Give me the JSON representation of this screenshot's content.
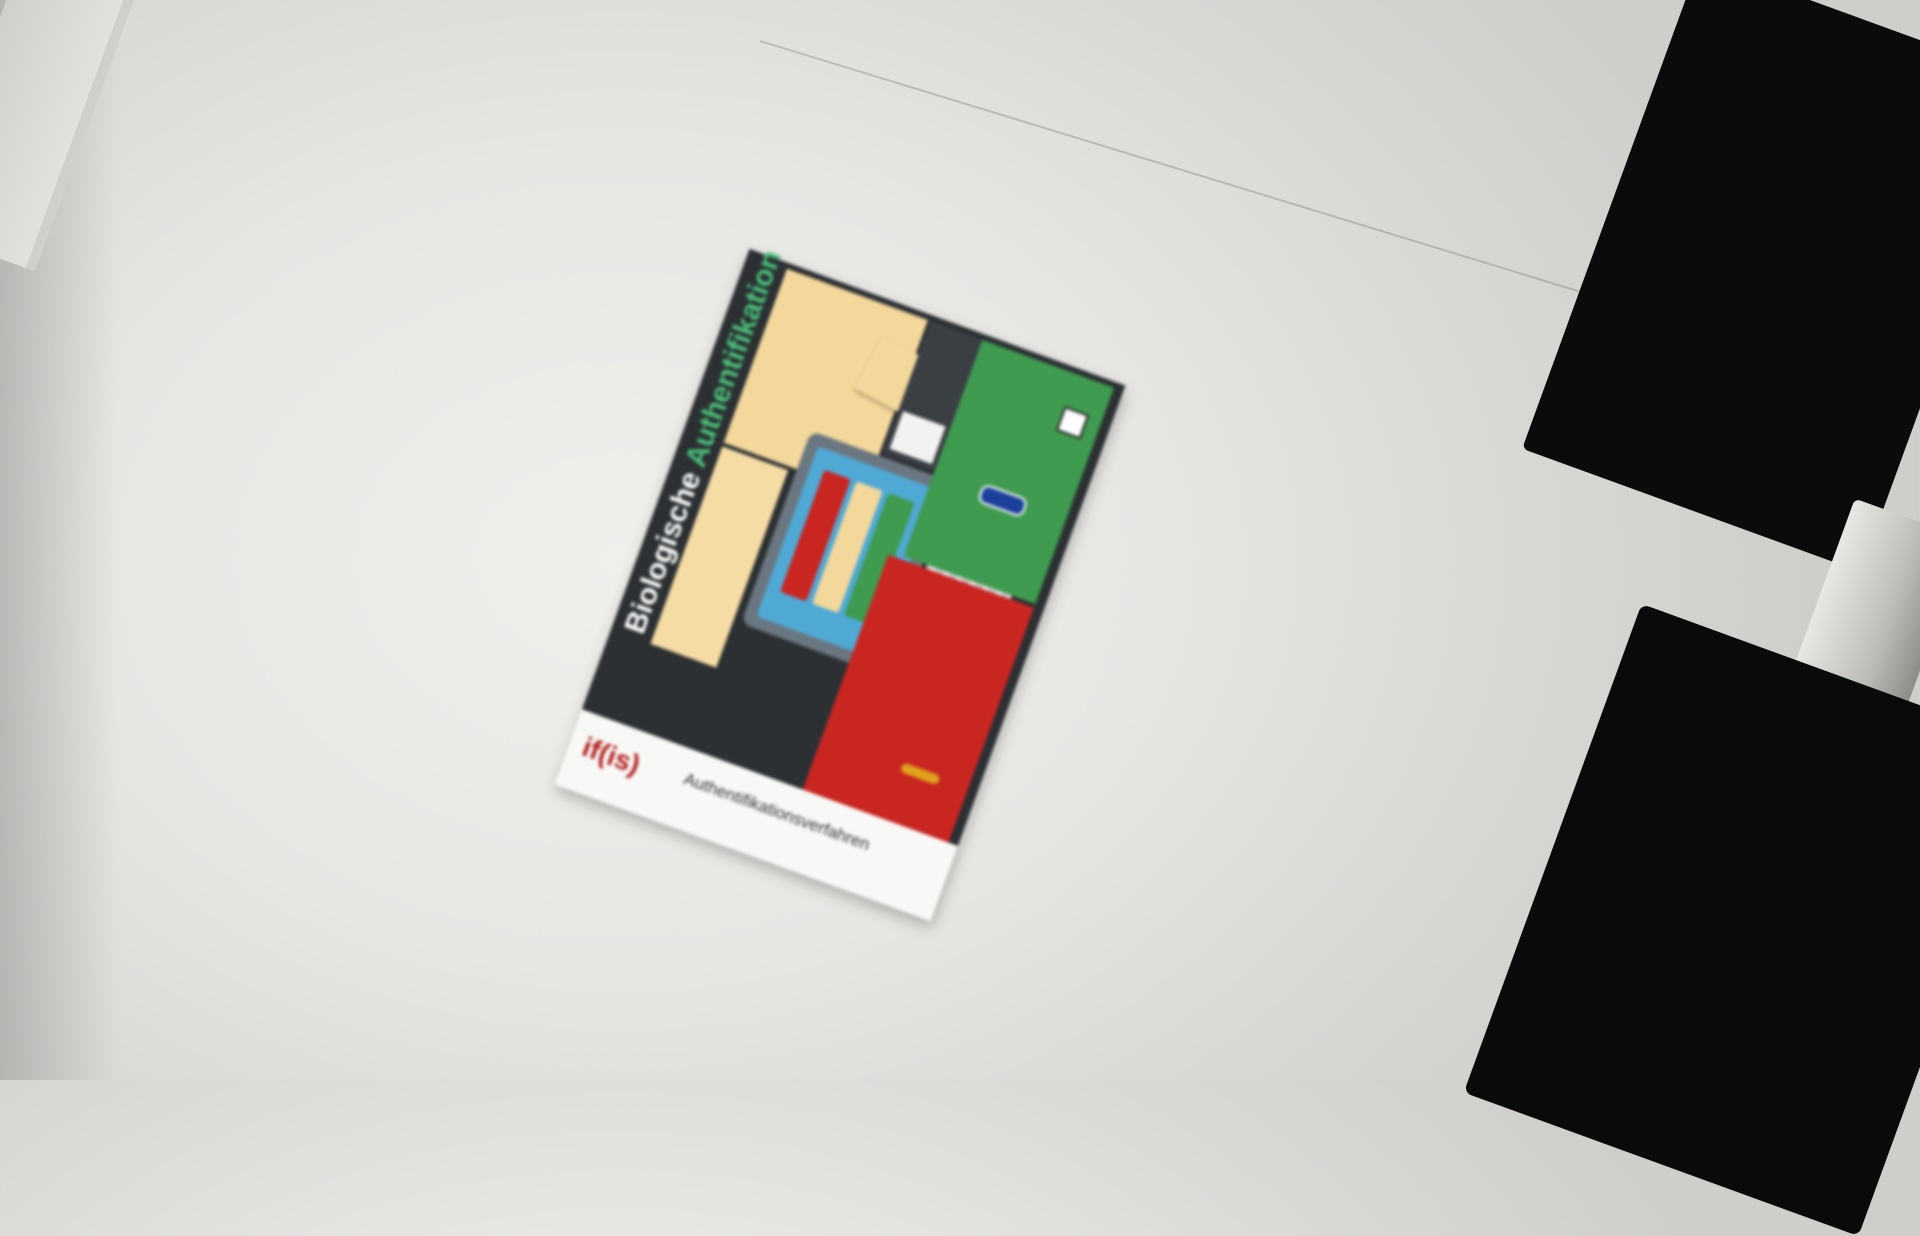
{
  "poster": {
    "title_part1": "Biologische ",
    "title_part2": "Authentifikation",
    "footer_label": "Authentifikationsverfahren",
    "logo": "if(is)"
  },
  "colors": {
    "wall": "#e7e6e3",
    "poster_dark": "#2c3033",
    "beige": "#f3d79b",
    "green": "#3f9b4f",
    "red": "#c92622",
    "monitor": "#0b0b0b",
    "title_accent": "#49c07a"
  }
}
